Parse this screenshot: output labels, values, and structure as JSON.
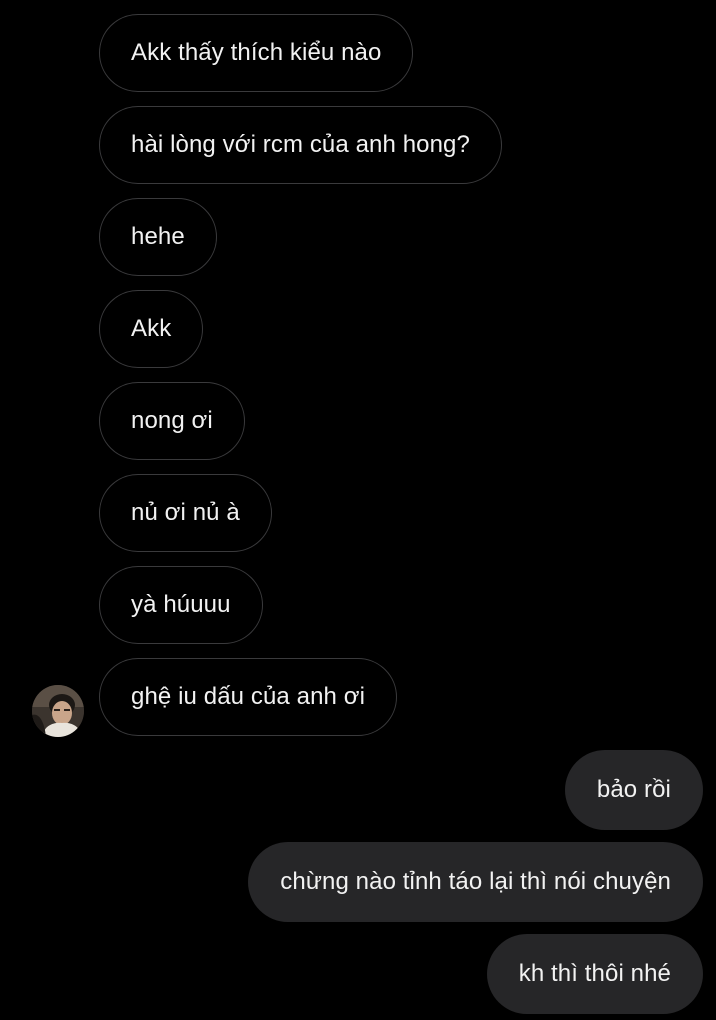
{
  "conversation": {
    "incoming_messages": [
      "Akk thấy thích kiểu nào",
      "hài lòng với rcm của anh hong?",
      "hehe",
      "Akk",
      "nong ơi",
      "nủ ơi nủ à",
      "yà húuuu",
      "ghệ iu dấu của anh ơi"
    ],
    "outgoing_messages": [
      "bảo rồi",
      "chừng nào tỉnh táo lại thì nói chuyện",
      "kh thì thôi nhé"
    ]
  },
  "colors": {
    "background": "#000000",
    "incoming_border": "#3a3a3c",
    "outgoing_fill": "#262628",
    "text": "#f2f2f2"
  },
  "icons": {
    "sender_avatar": "avatar-photo"
  }
}
